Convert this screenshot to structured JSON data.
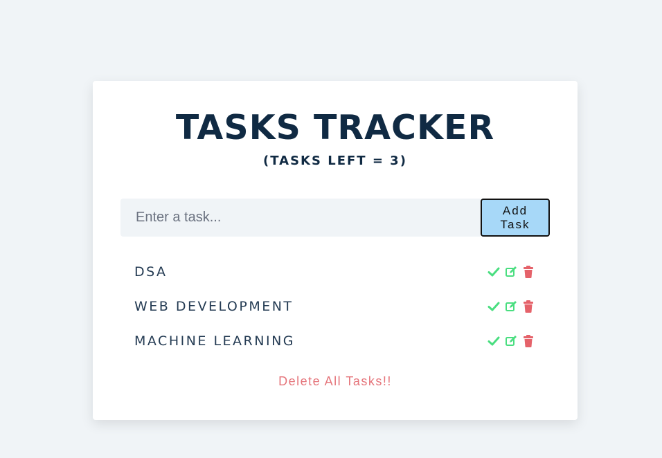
{
  "header": {
    "title": "TASKS TRACKER",
    "subtitle": "(TASKS LEFT = 3)"
  },
  "form": {
    "placeholder": "Enter a task...",
    "value": "",
    "add_label_line1": "Add",
    "add_label_line2": "Task"
  },
  "tasks": [
    {
      "name": "DSA",
      "icons": [
        "check-icon",
        "edit-icon",
        "trash-icon"
      ]
    },
    {
      "name": "WEB DEVELOPMENT",
      "icons": [
        "check-icon",
        "edit-icon",
        "trash-icon"
      ]
    },
    {
      "name": "MACHINE LEARNING",
      "icons": [
        "check-icon",
        "edit-icon",
        "trash-icon"
      ]
    }
  ],
  "footer": {
    "delete_all_label": "Delete All Tasks!!"
  },
  "colors": {
    "background": "#f0f4f7",
    "card": "#ffffff",
    "title": "#102a43",
    "add_button": "#a7d8f8",
    "check": "#4ade80",
    "edit": "#4ade80",
    "trash": "#e5626a",
    "delete_all": "#e5747a"
  }
}
